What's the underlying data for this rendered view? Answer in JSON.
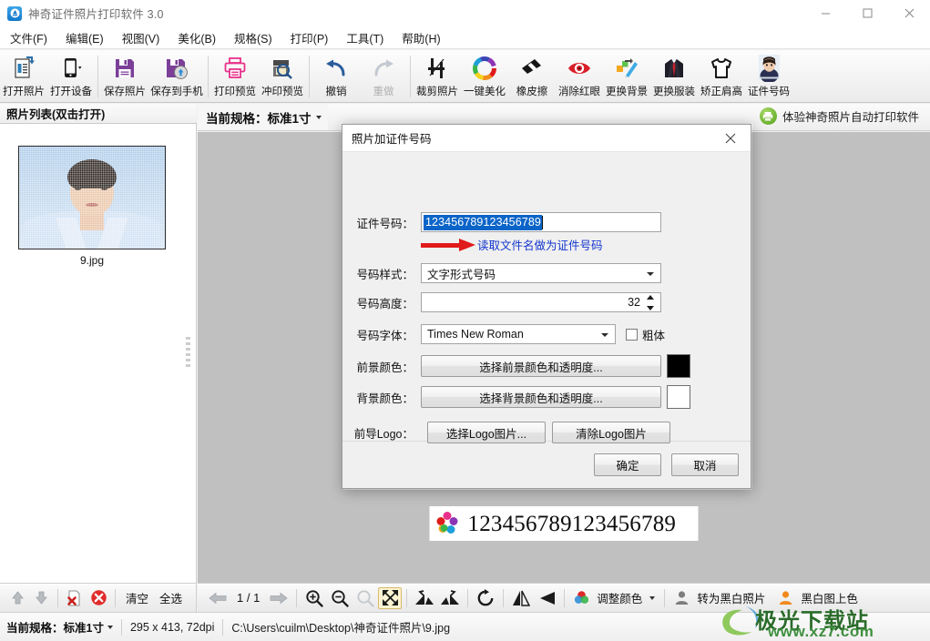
{
  "window": {
    "title": "神奇证件照片打印软件 3.0",
    "app_icon": "app-icon",
    "minimize": "—",
    "maximize": "□",
    "close": "✕"
  },
  "menubar": {
    "items": [
      {
        "label": "文件(F)"
      },
      {
        "label": "编辑(E)"
      },
      {
        "label": "视图(V)"
      },
      {
        "label": "美化(B)"
      },
      {
        "label": "规格(S)"
      },
      {
        "label": "打印(P)"
      },
      {
        "label": "工具(T)"
      },
      {
        "label": "帮助(H)"
      }
    ]
  },
  "toolbar": {
    "buttons": [
      {
        "label": "打开照片",
        "icon": "open-photo-icon",
        "enabled": true
      },
      {
        "label": "打开设备",
        "icon": "open-device-icon",
        "enabled": true
      },
      {
        "label": "保存照片",
        "icon": "save-photo-icon",
        "enabled": true
      },
      {
        "label": "保存到手机",
        "icon": "save-to-phone-icon",
        "enabled": true
      },
      {
        "label": "打印预览",
        "icon": "print-preview-icon",
        "enabled": true
      },
      {
        "label": "冲印预览",
        "icon": "develop-preview-icon",
        "enabled": true
      },
      {
        "label": "撤销",
        "icon": "undo-icon",
        "enabled": true
      },
      {
        "label": "重做",
        "icon": "redo-icon",
        "enabled": false
      },
      {
        "label": "裁剪照片",
        "icon": "crop-icon",
        "enabled": true
      },
      {
        "label": "一键美化",
        "icon": "beautify-icon",
        "enabled": true
      },
      {
        "label": "橡皮擦",
        "icon": "eraser-icon",
        "enabled": true
      },
      {
        "label": "消除红眼",
        "icon": "red-eye-icon",
        "enabled": true
      },
      {
        "label": "更换背景",
        "icon": "change-background-icon",
        "enabled": true
      },
      {
        "label": "更换服装",
        "icon": "change-clothes-icon",
        "enabled": true
      },
      {
        "label": "矫正肩高",
        "icon": "fix-shoulder-icon",
        "enabled": true
      },
      {
        "label": "证件号码",
        "icon": "id-number-icon",
        "enabled": true
      }
    ]
  },
  "left_panel": {
    "header": "照片列表(双击打开)",
    "thumbnail_name": "9.jpg",
    "toolbar": {
      "move_up": "move-up-icon",
      "move_down": "move-down-icon",
      "remove": "remove-file-icon",
      "delete": "delete-icon",
      "clear_label": "清空",
      "select_all_label": "全选"
    }
  },
  "spec_bar": {
    "label": "当前规格：标准1寸",
    "promo": "体验神奇照片自动打印软件"
  },
  "canvas": {
    "id_number_overlay": "123456789123456789"
  },
  "main_toolbar": {
    "prev": "prev-page-icon",
    "page": "1 / 1",
    "next": "next-page-icon",
    "zoom_in": "zoom-in-icon",
    "zoom_out": "zoom-out-icon",
    "zoom_reset": "zoom-reset-icon",
    "fit": "fit-screen-icon",
    "rotate_left": "rotate-left-icon",
    "rotate_right": "rotate-right-icon",
    "rotate_cw": "rotate-cw-icon",
    "flip_h": "flip-horizontal-icon",
    "flip_v": "flip-vertical-icon",
    "adjust_color_label": "调整颜色",
    "to_bw_label": "转为黑白照片",
    "colorize_label": "黑白图上色"
  },
  "status_bar": {
    "spec_label": "当前规格：标准1寸",
    "dimensions": "295 x 413, 72dpi",
    "path": "C:\\Users\\cuilm\\Desktop\\神奇证件照片\\9.jpg"
  },
  "watermark": {
    "main": "极光下载站",
    "sub": "www.xz7.com"
  },
  "dialog": {
    "title": "照片加证件号码",
    "close": "✕",
    "fields": {
      "id_number": {
        "label": "证件号码：",
        "value": "123456789123456789",
        "selected": true
      },
      "read_filename_link": "读取文件名做为证件号码",
      "number_style": {
        "label": "号码样式：",
        "value": "文字形式号码"
      },
      "number_height": {
        "label": "号码高度：",
        "value": "32"
      },
      "number_font": {
        "label": "号码字体：",
        "value": "Times New Roman",
        "bold_label": "粗体",
        "bold_checked": false
      },
      "foreground_color": {
        "label": "前景颜色：",
        "button": "选择前景颜色和透明度...",
        "swatch": "#000000"
      },
      "background_color": {
        "label": "背景颜色：",
        "button": "选择背景颜色和透明度...",
        "swatch": "#ffffff"
      },
      "logo": {
        "label": "前导Logo：",
        "select_button": "选择Logo图片...",
        "clear_button": "清除Logo图片"
      }
    },
    "footer": {
      "ok": "确定",
      "cancel": "取消"
    }
  },
  "colors": {
    "accent_blue": "#0b64c8",
    "link_blue": "#1436ce",
    "arrow_red": "#e01b1b",
    "magenta": "#e8308a",
    "purple": "#7b3f98"
  }
}
